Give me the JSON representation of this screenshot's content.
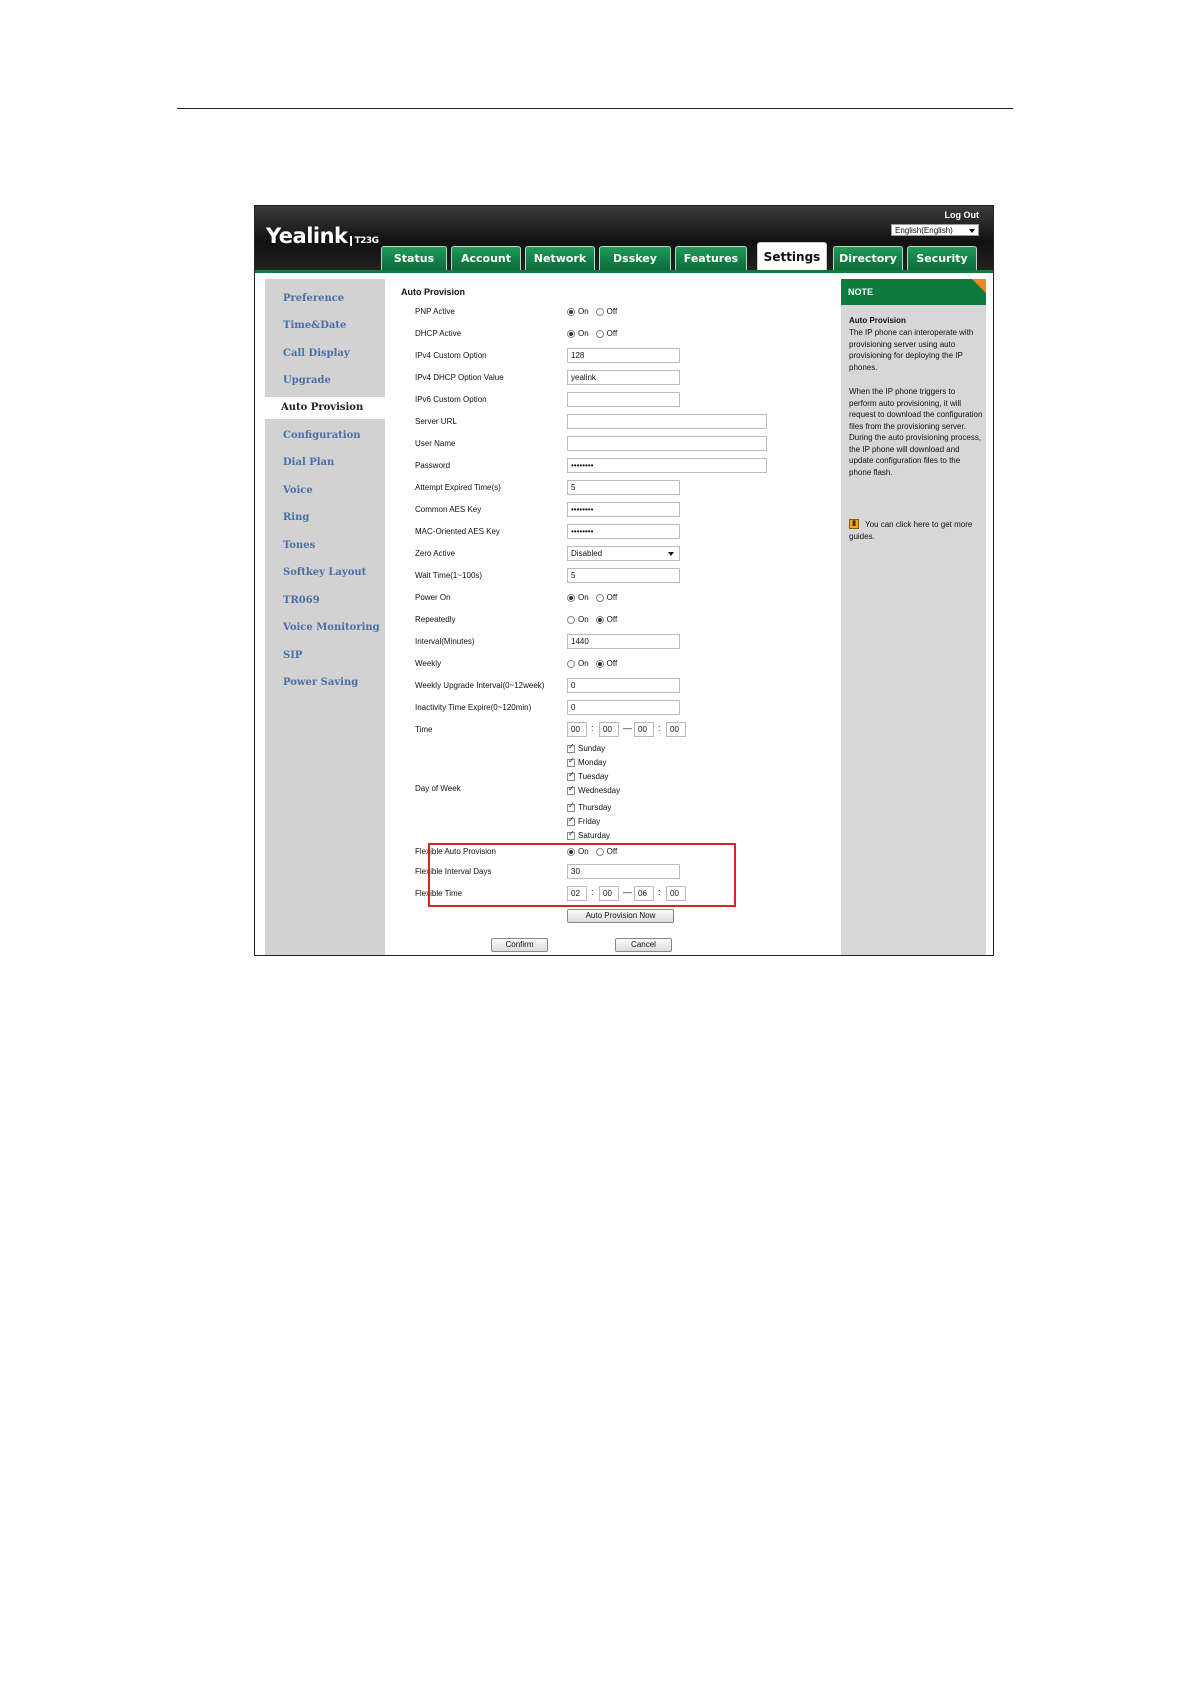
{
  "header": {
    "logo": "Yealink",
    "model": "T23G",
    "logout": "Log Out",
    "language": "English(English)"
  },
  "tabs": [
    "Status",
    "Account",
    "Network",
    "Dsskey",
    "Features",
    "Settings",
    "Directory",
    "Security"
  ],
  "active_tab": "Settings",
  "sidebar": {
    "items": [
      "Preference",
      "Time&Date",
      "Call Display",
      "Upgrade",
      "Auto Provision",
      "Configuration",
      "Dial Plan",
      "Voice",
      "Ring",
      "Tones",
      "Softkey Layout",
      "TR069",
      "Voice Monitoring",
      "SIP",
      "Power Saving"
    ],
    "active": "Auto Provision"
  },
  "form": {
    "title": "Auto Provision",
    "labels": {
      "pnp_active": "PNP Active",
      "dhcp_active": "DHCP Active",
      "ipv4_custom_option": "IPv4 Custom Option",
      "ipv4_dhcp_option_value": "IPv4 DHCP Option Value",
      "ipv6_custom_option": "IPv6 Custom Option",
      "server_url": "Server URL",
      "user_name": "User Name",
      "password": "Password",
      "attempt_expired_time": "Attempt Expired Time(s)",
      "common_aes_key": "Common AES Key",
      "mac_oriented_aes_key": "MAC-Oriented AES Key",
      "zero_active": "Zero Active",
      "wait_time": "Wait Time(1~100s)",
      "power_on": "Power On",
      "repeatedly": "Repeatedly",
      "interval_minutes": "Interval(Minutes)",
      "weekly": "Weekly",
      "weekly_upgrade_interval": "Weekly Upgrade Interval(0~12week)",
      "inactivity_time_expire": "Inactivity Time Expire(0~120min)",
      "time": "Time",
      "day_of_week": "Day of Week",
      "flexible_auto_provision": "Flexible Auto Provision",
      "flexible_interval_days": "Flexible Interval Days",
      "flexible_time": "Flexible Time"
    },
    "radio_on": "On",
    "radio_off": "Off",
    "values": {
      "ipv4_custom_option": "128",
      "ipv4_dhcp_option_value": "yealink",
      "ipv6_custom_option": "",
      "server_url": "",
      "user_name": "",
      "password": "••••••••",
      "attempt_expired_time": "5",
      "common_aes_key": "••••••••",
      "mac_oriented_aes_key": "••••••••",
      "zero_active": "Disabled",
      "wait_time": "5",
      "interval_minutes": "1440",
      "weekly_upgrade_interval": "0",
      "inactivity_time_expire": "0",
      "time_start_h": "00",
      "time_start_m": "00",
      "time_end_h": "00",
      "time_end_m": "00",
      "flexible_interval_days": "30",
      "flex_start_h": "02",
      "flex_start_m": "00",
      "flex_end_h": "06",
      "flex_end_m": "00"
    },
    "radios": {
      "pnp_active": "On",
      "dhcp_active": "On",
      "power_on": "On",
      "repeatedly": "Off",
      "weekly": "Off",
      "flexible_auto_provision": "On"
    },
    "time_colon": ":",
    "time_dash": "—",
    "days": [
      "Sunday",
      "Monday",
      "Tuesday",
      "Wednesday",
      "Thursday",
      "Friday",
      "Saturday"
    ],
    "days_checked": [
      true,
      true,
      true,
      true,
      true,
      true,
      true
    ],
    "buttons": {
      "auto_provision_now": "Auto Provision Now",
      "confirm": "Confirm",
      "cancel": "Cancel"
    }
  },
  "note": {
    "heading": "NOTE",
    "title": "Auto Provision",
    "para1": "The IP phone can interoperate with provisioning server using auto provisioning for deploying the IP phones.",
    "para2": "When the IP phone triggers to perform auto provisioning, it will request to download the configuration files from the provisioning server. During the auto provisioning process, the IP phone will download and update configuration files to the phone flash.",
    "guide": "You can click here to get more guides."
  },
  "colors": {
    "header_bg": "#1a1a1a",
    "tab_green": "#0f7a3e",
    "sidebar_link": "#4a6fa5",
    "highlight_box": "#dd2222",
    "note_corner": "#f08a24"
  }
}
